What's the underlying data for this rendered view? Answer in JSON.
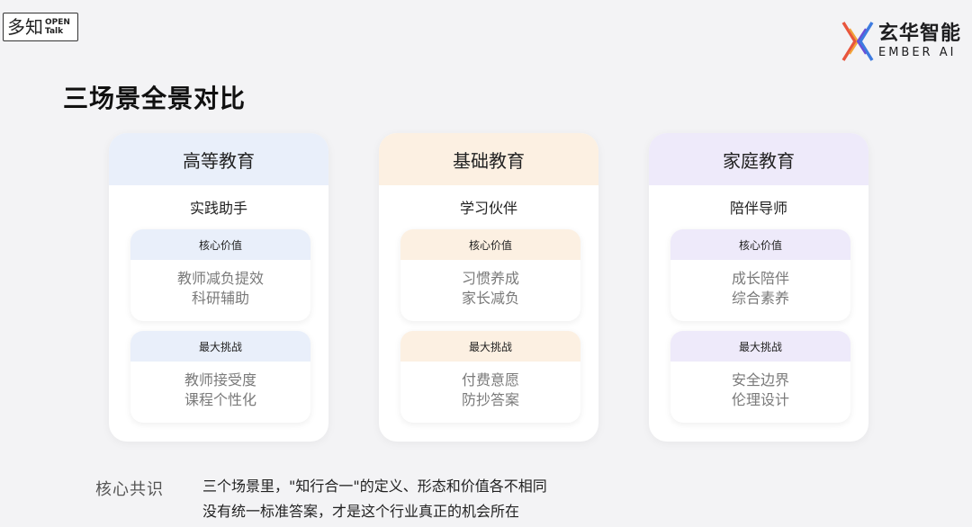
{
  "brand_left": {
    "cn": "多知",
    "open": "OPEN",
    "talk": "Talk"
  },
  "brand_right": {
    "cn": "玄华智能",
    "en": "EMBER AI",
    "accent_colors": [
      "#e8553d",
      "#3d7be0",
      "#f2a33a"
    ]
  },
  "page_title": "三场景全景对比",
  "columns": [
    {
      "title": "高等教育",
      "role": "实践助手",
      "value_label": "核心价值",
      "value_lines": [
        "教师减负提效",
        "科研辅助"
      ],
      "challenge_label": "最大挑战",
      "challenge_lines": [
        "教师接受度",
        "课程个性化"
      ],
      "accent": "#e9effa"
    },
    {
      "title": "基础教育",
      "role": "学习伙伴",
      "value_label": "核心价值",
      "value_lines": [
        "习惯养成",
        "家长减负"
      ],
      "challenge_label": "最大挑战",
      "challenge_lines": [
        "付费意愿",
        "防抄答案"
      ],
      "accent": "#fcf0e2"
    },
    {
      "title": "家庭教育",
      "role": "陪伴导师",
      "value_label": "核心价值",
      "value_lines": [
        "成长陪伴",
        "综合素养"
      ],
      "challenge_label": "最大挑战",
      "challenge_lines": [
        "安全边界",
        "伦理设计"
      ],
      "accent": "#eeeafa"
    }
  ],
  "consensus": {
    "label": "核心共识",
    "lines": [
      "三个场景里，\"知行合一\"的定义、形态和价值各不相同",
      "没有统一标准答案，才是这个行业真正的机会所在"
    ]
  }
}
